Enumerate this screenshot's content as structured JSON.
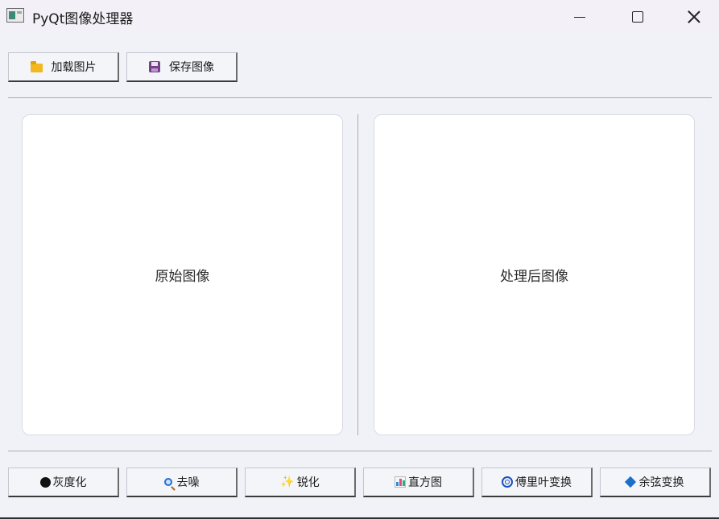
{
  "window": {
    "title": "PyQt图像处理器"
  },
  "toolbar": {
    "load_label": "加载图片",
    "save_label": "保存图像"
  },
  "panels": {
    "original_label": "原始图像",
    "processed_label": "处理后图像"
  },
  "ops": {
    "gray_label": "灰度化",
    "denoise_label": "去噪",
    "sharpen_label": "锐化",
    "histogram_label": "直方图",
    "fourier_label": "傅里叶变换",
    "cosine_label": "余弦变换"
  },
  "icons": {
    "load": "folder-icon",
    "save": "floppy-disk-icon",
    "gray": "black-circle-icon",
    "denoise": "magnifier-icon",
    "sharpen": "sparkles-icon",
    "histogram": "bar-chart-icon",
    "fourier": "cyclone-icon",
    "cosine": "blue-diamond-icon"
  }
}
